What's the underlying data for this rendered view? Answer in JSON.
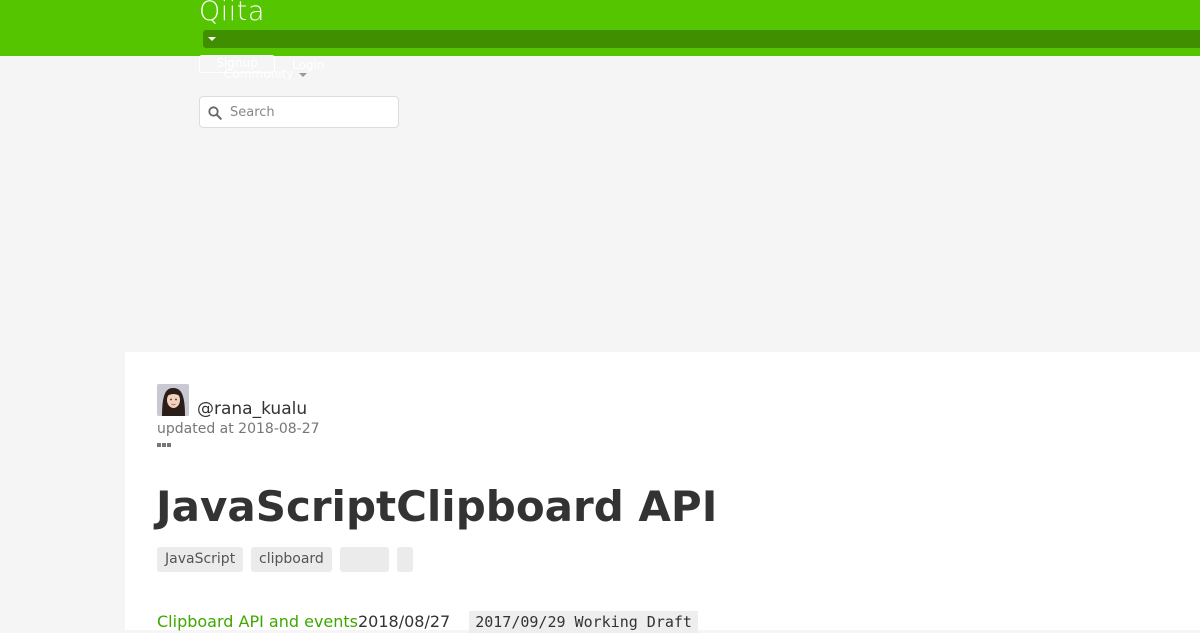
{
  "header": {
    "logo": "Qiita",
    "signup_label": "Signup",
    "login_label": "Login",
    "community_label": "Community",
    "search": {
      "placeholder": "Search"
    },
    "brand_color": "#55c500"
  },
  "article": {
    "author": "@rana_kualu",
    "updated": "updated at 2018-08-27",
    "title": "JavaScriptClipboard API",
    "tags": [
      "JavaScript",
      "clipboard",
      "",
      ""
    ],
    "body": {
      "link_text": "Clipboard API and events",
      "date_text": "2018/08/27",
      "code_text": "2017/09/29 Working Draft"
    },
    "link_color": "#3ea700"
  }
}
